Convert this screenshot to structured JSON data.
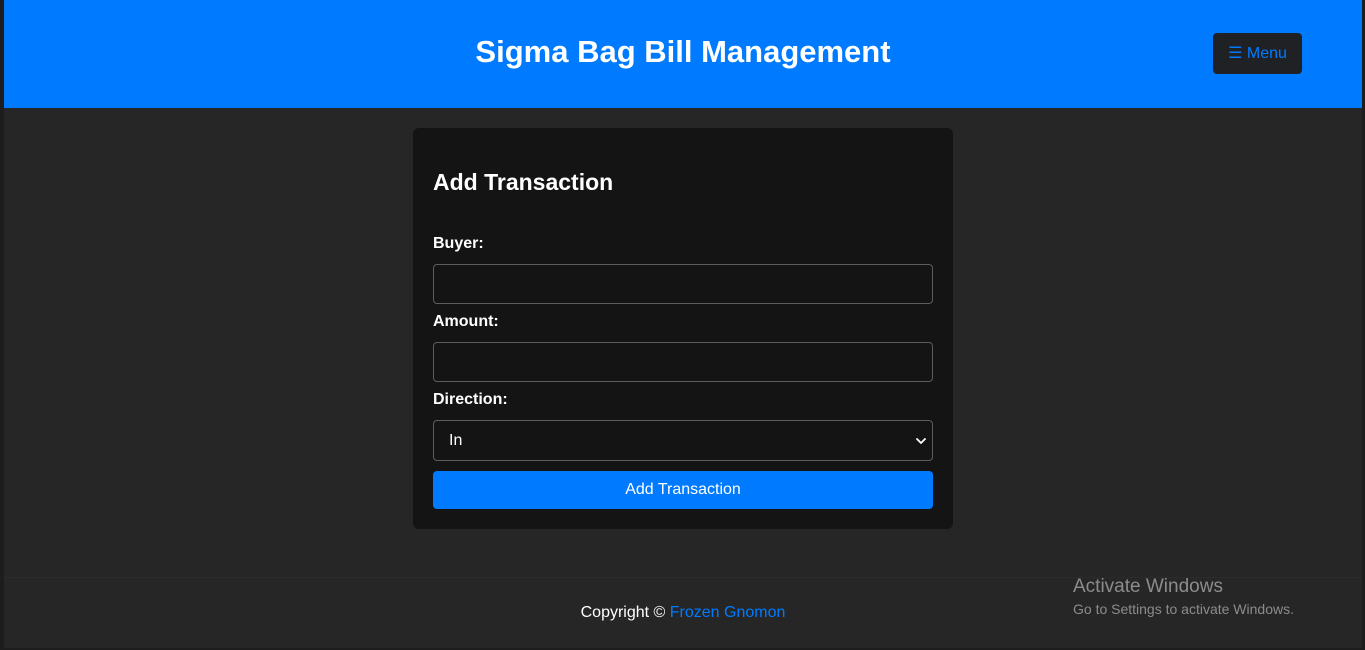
{
  "header": {
    "title": "Sigma Bag Bill Management",
    "menu_label": "☰ Menu"
  },
  "form": {
    "title": "Add Transaction",
    "buyer_label": "Buyer:",
    "buyer_value": "",
    "amount_label": "Amount:",
    "amount_value": "",
    "direction_label": "Direction:",
    "direction_selected": "In",
    "submit_label": "Add Transaction"
  },
  "footer": {
    "copyright_prefix": "Copyright © ",
    "author": "Frozen Gnomon"
  },
  "watermark": {
    "title": "Activate Windows",
    "subtitle": "Go to Settings to activate Windows."
  },
  "colors": {
    "accent": "#007bff",
    "background": "#262626",
    "card": "#141414"
  },
  "icons": {
    "menu": "hamburger-icon",
    "direction_dropdown": "chevron-down-icon"
  }
}
